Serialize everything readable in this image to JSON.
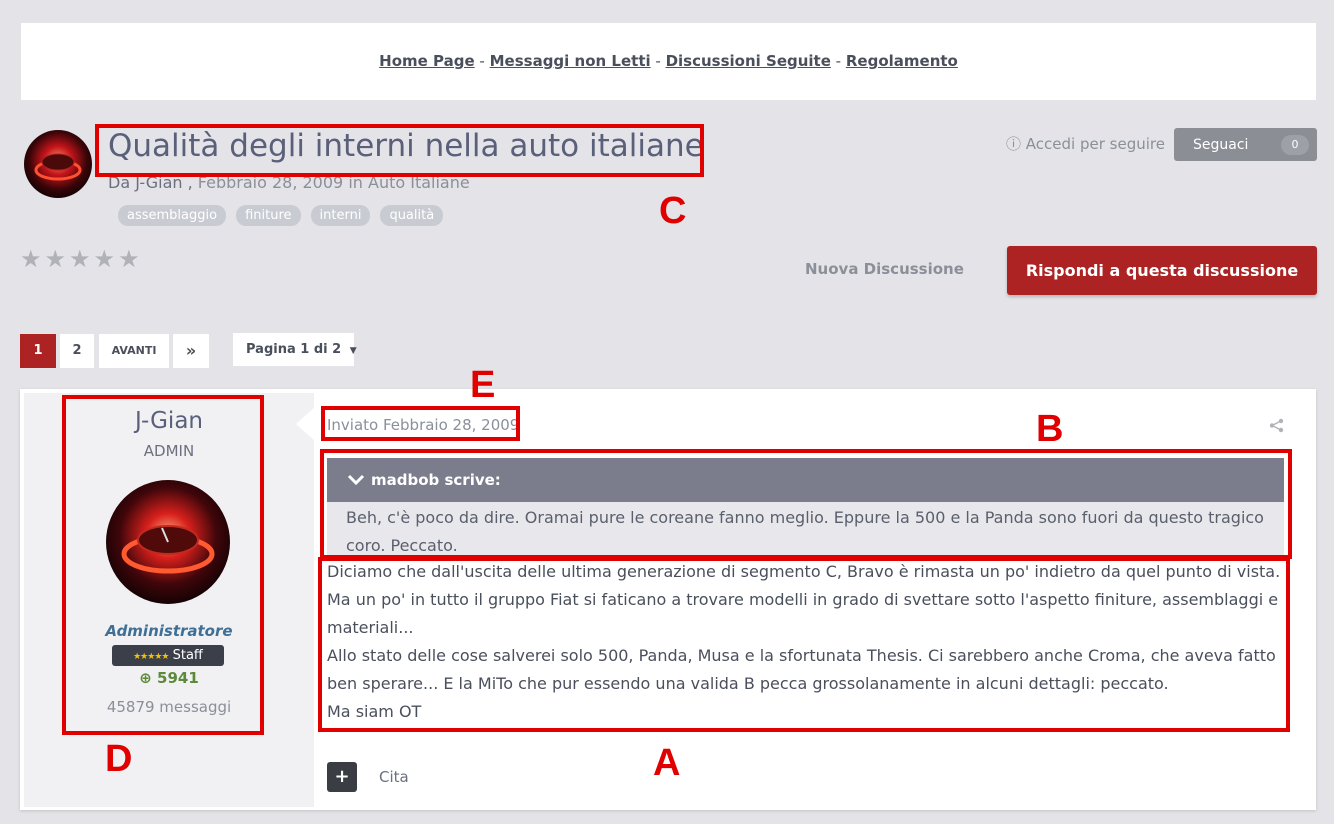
{
  "nav": {
    "links": [
      "Home Page",
      "Messaggi non Letti",
      "Discussioni Seguite",
      "Regolamento"
    ],
    "separator": " - "
  },
  "topic": {
    "title": "Qualità degli interni nella auto italiane",
    "by_prefix": "Da",
    "author": "J-Gian",
    "date": "Febbraio 28, 2009",
    "in_prefix": "in",
    "forum": "Auto Italiane",
    "tags": [
      "assemblaggio",
      "finiture",
      "interni",
      "qualità"
    ],
    "follow_text": "Accedi per seguire",
    "follow_button": "Seguaci",
    "follow_count": "0",
    "rating_stars": 5,
    "rating_value": 0
  },
  "actions": {
    "new_discussion": "Nuova Discussione",
    "reply": "Rispondi a questa discussione"
  },
  "pagination": {
    "pages": [
      "1",
      "2"
    ],
    "active": "1",
    "next": "AVANTI",
    "last": "»",
    "page_select": "Pagina 1 di 2"
  },
  "post": {
    "author_name": "J-Gian",
    "author_rank": "ADMIN",
    "author_group": "Administratore",
    "badge_stars": "★★★★★",
    "badge_label": "Staff",
    "reputation": "5941",
    "messages": "45879 messaggi",
    "posted": "Inviato Febbraio 28, 2009",
    "quote_author": "madbob scrive:",
    "quote_text": "Beh, c'è poco da dire. Oramai pure le coreane fanno meglio. Eppure la 500 e la Panda sono fuori da questo tragico coro. Peccato.",
    "lines": [
      "Diciamo che dall'uscita delle ultima generazione di segmento C, Bravo è rimasta un po' indietro da quel punto di vista.",
      "Ma un po' in tutto il gruppo Fiat si faticano a trovare modelli in grado di svettare sotto l'aspetto finiture, assemblaggi e materiali...",
      "Allo stato delle cose salverei solo 500, Panda, Musa e la sfortunata Thesis. Ci sarebbero anche Croma, che aveva fatto ben sperare... E la MiTo che pur essendo una valida B pecca grossolanamente in alcuni dettagli: peccato.",
      "Ma siam OT"
    ],
    "quote_button": "Cita"
  },
  "annotations": [
    "A",
    "B",
    "C",
    "D",
    "E"
  ],
  "colors": {
    "accent": "#ad2323",
    "annotation": "#e00000",
    "quote_header": "#7b7d8c",
    "page_bg": "#e4e4e8"
  }
}
